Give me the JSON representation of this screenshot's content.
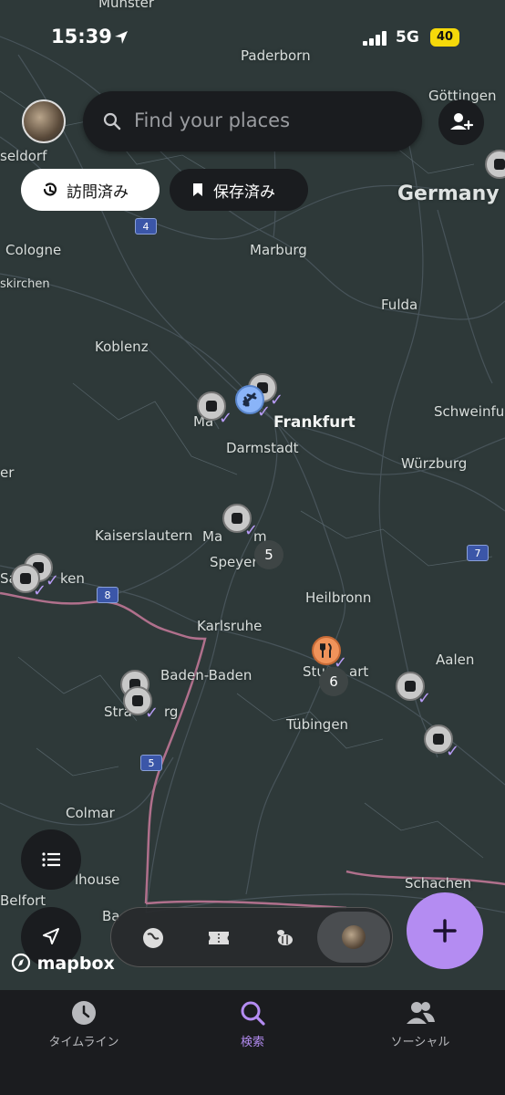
{
  "status_bar": {
    "time": "15:39",
    "network": "5G",
    "battery": "40"
  },
  "search": {
    "placeholder": "Find your places"
  },
  "filters": {
    "visited": "訪問済み",
    "saved": "保存済み"
  },
  "map": {
    "cities": {
      "munster": "Münster",
      "paderborn": "Paderborn",
      "gottingen": "Göttingen",
      "dusseldorf": "seldorf",
      "cologne": "Cologne",
      "kirchen": "skirchen",
      "marburg": "Marburg",
      "fulda": "Fulda",
      "koblenz": "Koblenz",
      "schweinfurt": "Schweinfu",
      "frankfurt": "Frankfurt",
      "mainz": "Ma",
      "darmstadt": "Darmstadt",
      "wurzburg": "Würzburg",
      "kaiserslautern": "Kaiserslautern",
      "mannheim": "Ma",
      "mannheim2": "m",
      "speyer": "Speyer",
      "saarbrucken": "Sa",
      "saarbrucken2": "ken",
      "heilbronn": "Heilbronn",
      "karlsruhe": "Karlsruhe",
      "baden": "Baden-Baden",
      "stuttgart": "Stu",
      "stuttgart2": "art",
      "aalen": "Aalen",
      "strasbourg": "Stra",
      "strasbourg2": "rg",
      "tubingen": "Tübingen",
      "colmar": "Colmar",
      "mulhouse": "lhouse",
      "schachen": "Schachen",
      "belfort": "Belfort",
      "ba": "Ba",
      "er": "er"
    },
    "country": "Germany",
    "road_badges": {
      "a4": "4",
      "a7": "7",
      "a8": "8",
      "a5": "5"
    },
    "clusters": {
      "mannheim": "5",
      "stuttgart": "6"
    },
    "attribution": "mapbox"
  },
  "tabs": {
    "timeline": "タイムライン",
    "search": "検索",
    "social": "ソーシャル"
  },
  "colors": {
    "accent": "#b48cf2",
    "visited_check": "#b79bf5",
    "map_bg": "#2e3939"
  }
}
